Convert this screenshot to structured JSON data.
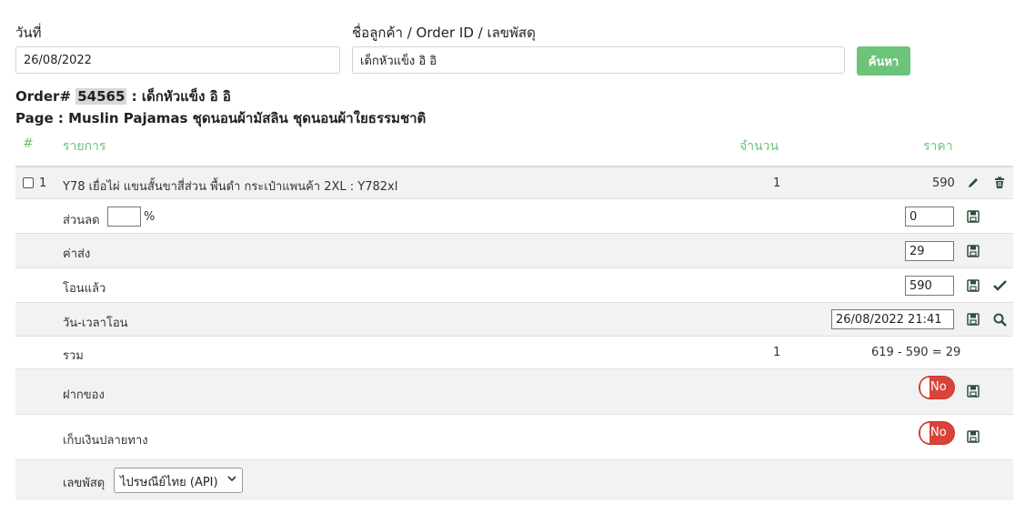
{
  "search": {
    "date_label": "วันที่",
    "date_value": "26/08/2022",
    "customer_label": "ชื่อลูกค้า / Order ID / เลขพัสดุ",
    "customer_value": "เด็กหัวแข็ง อิ อิ",
    "button_label": "ค้นหา"
  },
  "order": {
    "prefix": "Order# ",
    "id": "54565",
    "customer_suffix": " : เด็กหัวแข็ง อิ อิ",
    "page_line": "Page : Muslin Pajamas ชุดนอนผ้ามัสลิน ชุดนอนผ้าใยธรรมชาติ"
  },
  "table": {
    "headers": {
      "num": "#",
      "item": "รายการ",
      "qty": "จำนวน",
      "price": "ราคา"
    },
    "item": {
      "num": "1",
      "name": "Y78 เยื่อไผ่ แขนสั้นขาสี่ส่วน พื้นดำ กระเป๋าแพนค้า 2XL : Y782xl",
      "qty": "1",
      "price": "590"
    },
    "discount": {
      "label": "ส่วนลด",
      "percent_value": "",
      "percent_sign": "%",
      "value": "0"
    },
    "shipping": {
      "label": "ค่าส่ง",
      "value": "29"
    },
    "transferred": {
      "label": "โอนแล้ว",
      "value": "590"
    },
    "transfer_time": {
      "label": "วัน-เวลาโอน",
      "value": "26/08/2022 21:41"
    },
    "total": {
      "label": "รวม",
      "qty": "1",
      "calc": "619 - 590 = 29"
    },
    "deposit": {
      "label": "ฝากของ",
      "toggle": "No"
    },
    "cod": {
      "label": "เก็บเงินปลายทาง",
      "toggle": "No"
    },
    "tracking": {
      "label": "เลขพัสดุ",
      "selected": "ไปรษณีย์ไทย (API)"
    }
  },
  "colors": {
    "accent": "#6cc47a",
    "icon": "#2f4f3a",
    "toggle_off": "#d9433a"
  }
}
